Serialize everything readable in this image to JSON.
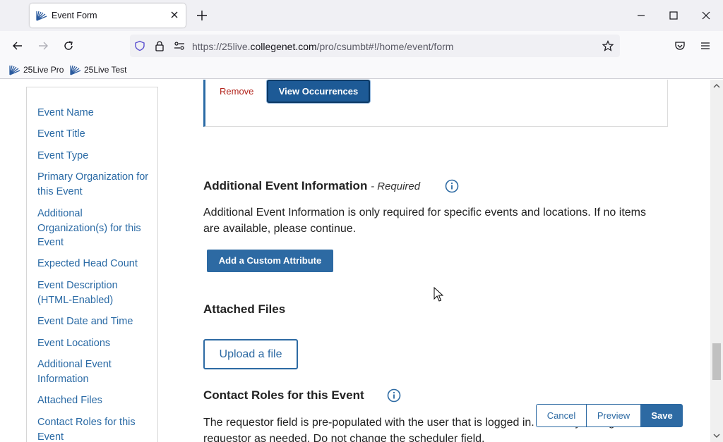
{
  "browser": {
    "tab_title": "Event Form",
    "url_prefix": "https://25live.",
    "url_host": "collegenet.com",
    "url_path": "/pro/csumbt#!/home/event/form",
    "bookmarks": [
      "25Live Pro",
      "25Live Test"
    ]
  },
  "sidebar": {
    "items": [
      "Event Name",
      "Event Title",
      "Event Type",
      "Primary Organization for this Event",
      "Additional Organization(s) for this Event",
      "Expected Head Count",
      "Event Description (HTML-Enabled)",
      "Event Date and Time",
      "Event Locations",
      "Additional Event Information",
      "Attached Files",
      "Contact Roles for this Event"
    ]
  },
  "occurrences": {
    "remove_label": "Remove",
    "view_label": "View Occurrences"
  },
  "additional_info": {
    "heading": "Additional Event Information",
    "required_label": "- Required",
    "description": "Additional Event Information is only required for specific events and locations. If no items are available, please continue.",
    "add_button": "Add a Custom Attribute"
  },
  "attached_files": {
    "heading": "Attached Files",
    "upload_button": "Upload a file"
  },
  "contact_roles": {
    "heading": "Contact Roles for this Event",
    "description": "The requestor field is pre-populated with the user that is logged in. You may change the requestor as needed. Do not change the scheduler field."
  },
  "actions": {
    "cancel": "Cancel",
    "preview": "Preview",
    "save": "Save"
  },
  "colors": {
    "link": "#2a6aa5",
    "primary": "#2d6aa3",
    "remove": "#b3261e"
  }
}
